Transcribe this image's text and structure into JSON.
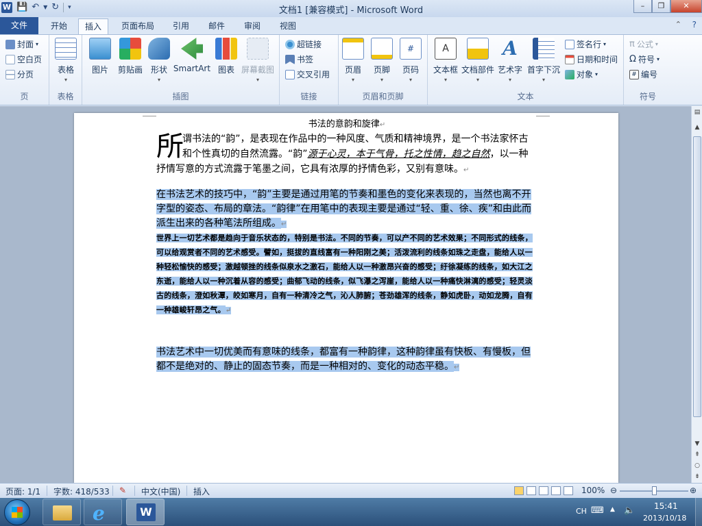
{
  "window": {
    "title": "文档1 [兼容模式] - Microsoft Word",
    "logo": "W",
    "minimize": "–",
    "restore": "❐",
    "close": "✕"
  },
  "qat": {
    "save_icon": "save-icon",
    "undo_icon": "undo-icon",
    "redo_icon": "redo-icon",
    "customize_icon": "chevron-down-icon"
  },
  "tabs": {
    "file": "文件",
    "home": "开始",
    "insert": "插入",
    "layout": "页面布局",
    "references": "引用",
    "mailings": "邮件",
    "review": "审阅",
    "view": "视图"
  },
  "ribbon": {
    "pages": {
      "label": "页",
      "cover": "封面",
      "blank": "空白页",
      "break": "分页"
    },
    "tables": {
      "label": "表格",
      "table": "表格"
    },
    "illustrations": {
      "label": "插图",
      "picture": "图片",
      "clipart": "剪贴画",
      "shapes": "形状",
      "smartart": "SmartArt",
      "chart": "图表",
      "screenshot": "屏幕截图"
    },
    "links": {
      "label": "链接",
      "hyperlink": "超链接",
      "bookmark": "书签",
      "crossref": "交叉引用"
    },
    "headerfooter": {
      "label": "页眉和页脚",
      "header": "页眉",
      "footer": "页脚",
      "pagenum": "页码"
    },
    "text": {
      "label": "文本",
      "textbox": "文本框",
      "quickparts": "文档部件",
      "wordart": "艺术字",
      "dropcap": "首字下沉",
      "sigline": "签名行",
      "datetime": "日期和时间",
      "object": "对象"
    },
    "symbols": {
      "label": "符号",
      "equation": "公式",
      "symbol": "符号",
      "number": "编号"
    }
  },
  "document": {
    "title": "书法的意韵和旋律",
    "p1_dropcap": "所",
    "p1_a": "谓书法的“韵”，是表现在作品中的一种风度、气质和精神境界，是一个书法家怀古和个性真切的自然流露。“韵”",
    "p1_italic": "源于心灵，本于气骨，托之性情，趋之自然",
    "p1_b": "，以一种抒情写意的方式流露于笔墨之间，它具有浓厚的抒情色彩，又别有意味。",
    "p2": "在书法艺术的技巧中，“韵”主要是通过用笔的节奏和墨色的变化来表现的，当然也离不开字型的姿态、布局的章法。“韵律”在用笔中的表现主要是通过“轻、重、徐、疾”和由此而派生出来的各种笔法所组成。",
    "p3": "世界上一切艺术都是趋向于音乐状态的，特别是书法。不同的节奏，可以产不同的艺术效果；不同形式的线条，可以给观赏者不同的艺术感受。譬如，挺拔的直线富有一种阳刚之美；活泼流利的线条如珠之走盘，能给人以一种轻松愉快的感受；激越顿挫的线条似泉水之激石，能给人以一种激昂兴奋的感受；纡徐凝练的线条，如大江之东逝，能给人以一种沉着从容的感受；曲郁飞动的线条，似飞瀑之泻崖，能给人以一种痛快淋漓的感受；轻灵淡古的线条，澄如秋潭，皎如寒月，自有一种清冷之气，沁人肺腑；苍劲雄浑的线条，静如虎卧，动如龙腾，自有一种雄峻轩昂之气。",
    "p4": "书法艺术中一切优美而有意味的线条，都富有一种韵律，这种韵律虽有快板、有慢板，但都不是绝对的、静止的固态节奏，而是一种相对的、变化的动态平稳。",
    "para_mark": "↵"
  },
  "status": {
    "page": "页面: 1/1",
    "words": "字数: 418/533",
    "lang": "中文(中国)",
    "mode": "插入",
    "zoom": "100%"
  },
  "taskbar": {
    "ime": "CH",
    "time": "15:41",
    "date": "2013/10/18"
  },
  "colors": {
    "accent": "#2b579a",
    "selection": "#a8c9ef"
  }
}
